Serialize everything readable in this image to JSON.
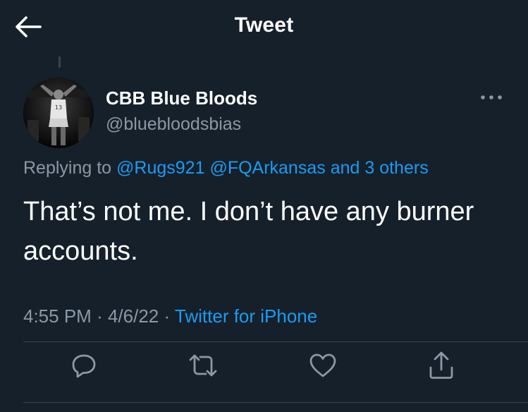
{
  "header": {
    "title": "Tweet"
  },
  "tweet": {
    "display_name": "CBB Blue Bloods",
    "handle": "@bluebloodsbias",
    "replying_prefix": "Replying to ",
    "replying_users": [
      "@Rugs921",
      "@FQArkansas"
    ],
    "replying_others": "and 3 others",
    "text": "That’s not me. I don’t have any burner accounts.",
    "time": "4:55 PM",
    "date": "4/6/22",
    "source": "Twitter for iPhone"
  },
  "icons": {
    "back": "arrow-left-icon",
    "more": "more-horizontal-icon",
    "reply": "reply-icon",
    "retweet": "retweet-icon",
    "like": "heart-icon",
    "share": "share-icon"
  },
  "colors": {
    "background": "#15202b",
    "text": "#ffffff",
    "secondary_text": "#8b98a5",
    "accent": "#1d9bf0",
    "divider": "#38444d"
  }
}
